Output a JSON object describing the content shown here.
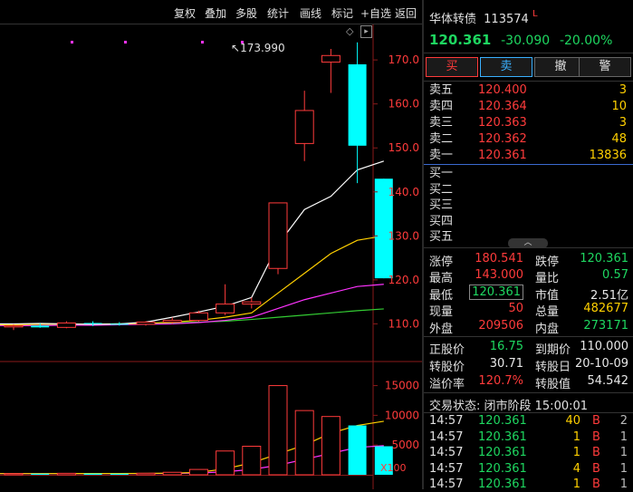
{
  "toolbar": {
    "items": [
      "复权",
      "叠加",
      "多股",
      "统计",
      "画线",
      "标记",
      "+自选",
      "返回"
    ]
  },
  "chart": {
    "high_label": "173.990",
    "price_ticks": [
      "170.0",
      "160.0",
      "150.0",
      "140.0",
      "130.0",
      "120.0",
      "110.0"
    ],
    "vol_ticks": [
      "15000",
      "10000",
      "5000"
    ],
    "vol_unit": "X100",
    "colors": {
      "up": "#ff3b3b",
      "down": "#00ffff",
      "ma5": "#ffffff",
      "ma10": "#ffd000",
      "ma20": "#ff33ff",
      "ma60": "#33cc33"
    }
  },
  "chart_data": {
    "type": "candlestick",
    "ylim": [
      107,
      176
    ],
    "vol_ylim": [
      0,
      16000
    ],
    "candles": [
      {
        "o": 109.3,
        "h": 109.9,
        "l": 108.6,
        "c": 109.6,
        "v": 200
      },
      {
        "o": 109.6,
        "h": 110.1,
        "l": 109.1,
        "c": 109.2,
        "v": 180
      },
      {
        "o": 109.2,
        "h": 110.6,
        "l": 109.0,
        "c": 110.2,
        "v": 250
      },
      {
        "o": 110.2,
        "h": 110.6,
        "l": 109.5,
        "c": 110.0,
        "v": 200
      },
      {
        "o": 110.0,
        "h": 110.4,
        "l": 109.6,
        "c": 109.9,
        "v": 180
      },
      {
        "o": 109.9,
        "h": 110.6,
        "l": 109.6,
        "c": 110.4,
        "v": 260
      },
      {
        "o": 110.4,
        "h": 111.5,
        "l": 110.0,
        "c": 110.8,
        "v": 420
      },
      {
        "o": 110.8,
        "h": 113.0,
        "l": 110.5,
        "c": 112.5,
        "v": 900
      },
      {
        "o": 112.5,
        "h": 119.0,
        "l": 112.0,
        "c": 114.5,
        "v": 4000
      },
      {
        "o": 114.5,
        "h": 116.0,
        "l": 113.5,
        "c": 115.0,
        "v": 4800
      },
      {
        "o": 122.6,
        "h": 137.5,
        "l": 121.3,
        "c": 137.5,
        "v": 15000
      },
      {
        "o": 151.0,
        "h": 163.0,
        "l": 147.0,
        "c": 158.5,
        "v": 10800
      },
      {
        "o": 169.5,
        "h": 172.5,
        "l": 162.5,
        "c": 171.0,
        "v": 9800
      },
      {
        "o": 169.0,
        "h": 173.99,
        "l": 142.0,
        "c": 150.5,
        "v": 8300
      },
      {
        "o": 143.0,
        "h": 143.0,
        "l": 120.361,
        "c": 120.361,
        "v": 4800
      }
    ],
    "ma5": [
      110.0,
      110.1,
      110.0,
      109.9,
      110.0,
      110.4,
      111.5,
      112.7,
      114.0,
      116.0,
      128.0,
      136.0,
      139.0,
      145.0,
      147.0
    ],
    "ma10": [
      109.8,
      109.9,
      110.0,
      109.9,
      110.0,
      110.1,
      110.4,
      110.8,
      111.5,
      112.5,
      117.0,
      121.5,
      126.0,
      129.0,
      130.0
    ],
    "ma20": [
      109.6,
      109.6,
      109.7,
      109.7,
      109.8,
      109.9,
      110.0,
      110.3,
      110.8,
      111.5,
      113.5,
      115.5,
      117.0,
      118.5,
      119.0
    ],
    "ma60": [
      109.9,
      109.9,
      109.9,
      110.0,
      110.0,
      110.1,
      110.2,
      110.4,
      110.6,
      111.0,
      111.5,
      112.0,
      112.5,
      113.0,
      113.4
    ],
    "vol_ma5": [
      200,
      200,
      210,
      215,
      220,
      230,
      280,
      400,
      1000,
      2000,
      3500,
      5000,
      7000,
      8300,
      9000
    ],
    "vol_ma10": [
      200,
      200,
      200,
      205,
      210,
      215,
      230,
      300,
      500,
      900,
      1600,
      2600,
      3600,
      4600,
      4900
    ]
  },
  "quote": {
    "name": "华体转债",
    "code": "113574",
    "flag": "L",
    "price": "120.361",
    "change": "-30.090",
    "pct": "-20.00%"
  },
  "actions": {
    "buy": "买",
    "sell": "卖",
    "cancel": "撤",
    "alert": "警"
  },
  "asks": [
    {
      "label": "卖五",
      "price": "120.400",
      "vol": "3"
    },
    {
      "label": "卖四",
      "price": "120.364",
      "vol": "10"
    },
    {
      "label": "卖三",
      "price": "120.363",
      "vol": "3"
    },
    {
      "label": "卖二",
      "price": "120.362",
      "vol": "48"
    },
    {
      "label": "卖一",
      "price": "120.361",
      "vol": "13836"
    }
  ],
  "bids": [
    "买一",
    "买二",
    "买三",
    "买四",
    "买五"
  ],
  "stats": {
    "zhangting_l": "涨停",
    "zhangting": "180.541",
    "dieting_l": "跌停",
    "dieting": "120.361",
    "high_l": "最高",
    "high": "143.000",
    "liangbi_l": "量比",
    "liangbi": "0.57",
    "low_l": "最低",
    "low": "120.361",
    "shizhi_l": "市值",
    "shizhi": "2.51亿",
    "xianliang_l": "现量",
    "xianliang": "50",
    "zongliang_l": "总量",
    "zongliang": "482677",
    "waipan_l": "外盘",
    "waipan": "209506",
    "neipan_l": "内盘",
    "neipan": "273171"
  },
  "bond": {
    "zgj_l": "正股价",
    "zgj": "16.75",
    "dqj_l": "到期价",
    "dqj": "110.000",
    "zgjia_l": "转股价",
    "zgjia": "30.71",
    "zgr_l": "转股日",
    "zgr": "20-10-09",
    "yjl_l": "溢价率",
    "yjl": "120.7%",
    "zgz_l": "转股值",
    "zgz": "54.542"
  },
  "trade_status": "交易状态: 闭市阶段 15:00:01",
  "ticks": [
    {
      "time": "14:57",
      "price": "120.361",
      "vol": "40",
      "side": "B",
      "n": "2"
    },
    {
      "time": "14:57",
      "price": "120.361",
      "vol": "1",
      "side": "B",
      "n": "1"
    },
    {
      "time": "14:57",
      "price": "120.361",
      "vol": "1",
      "side": "B",
      "n": "1"
    },
    {
      "time": "14:57",
      "price": "120.361",
      "vol": "4",
      "side": "B",
      "n": "1"
    },
    {
      "time": "14:57",
      "price": "120.361",
      "vol": "1",
      "side": "B",
      "n": "1"
    }
  ]
}
